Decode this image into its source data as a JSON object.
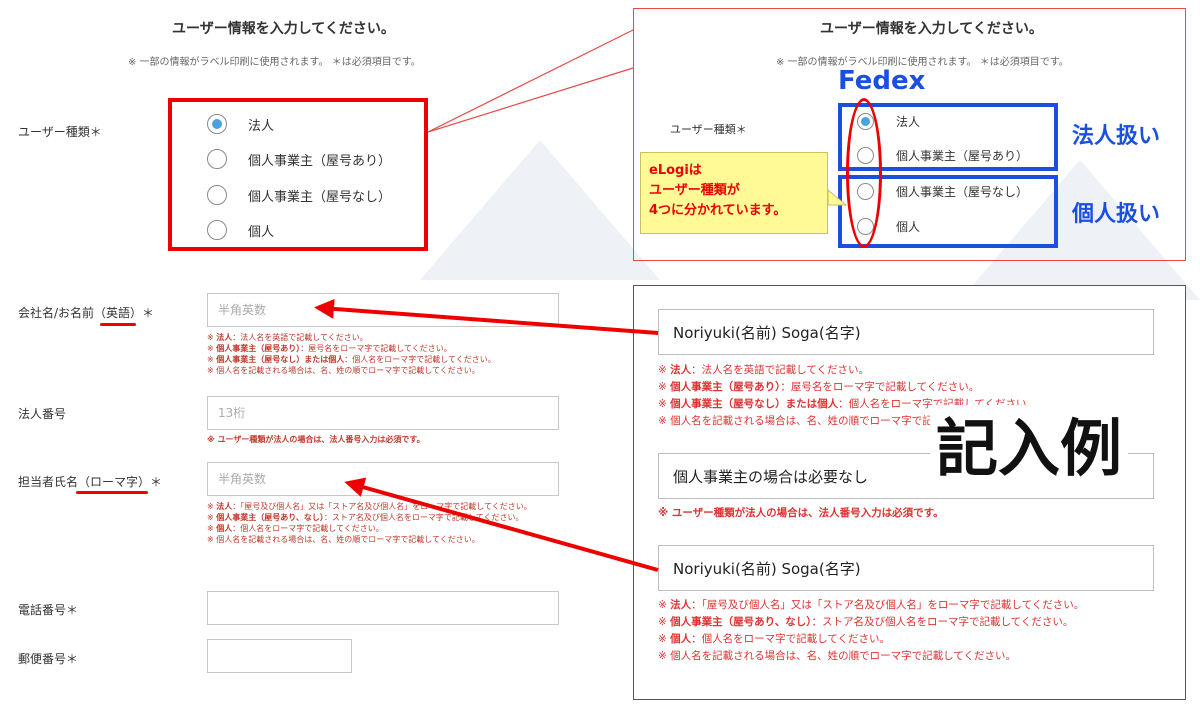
{
  "left_form": {
    "title": "ユーザー情報を入力してください。",
    "subtitle": "※ 一部の情報がラベル印刷に使用されます。 ＊は必須項目です。",
    "user_type": {
      "label": "ユーザー種類＊",
      "options": [
        {
          "label": "法人",
          "selected": true
        },
        {
          "label": "個人事業主（屋号あり）",
          "selected": false
        },
        {
          "label": "個人事業主（屋号なし）",
          "selected": false
        },
        {
          "label": "個人",
          "selected": false
        }
      ]
    },
    "company_name": {
      "label": "会社名/お名前（英語）＊",
      "placeholder": "半角英数",
      "hints": [
        {
          "prefix": "※ ",
          "bold": "法人",
          "rest": "：法人名を英語で記載してください。"
        },
        {
          "prefix": "※ ",
          "bold": "個人事業主（屋号あり）",
          "rest": "：屋号名をローマ字で記載してください。"
        },
        {
          "prefix": "※ ",
          "bold": "個人事業主（屋号なし）または個人",
          "rest": "：個人名をローマ字で記載してください。"
        },
        {
          "prefix": "※ ",
          "bold": "",
          "rest": "個人名を記載される場合は、名、姓の順でローマ字で記載してください。"
        }
      ]
    },
    "corp_number": {
      "label": "法人番号",
      "placeholder": "13桁",
      "hint": "※ ユーザー種類が法人の場合は、法人番号入力は必須です。"
    },
    "contact_name": {
      "label": "担当者氏名（ローマ字）＊",
      "placeholder": "半角英数",
      "hints": [
        {
          "prefix": "※ ",
          "bold": "法人",
          "rest": "：「屋号及び個人名」又は「ストア名及び個人名」をローマ字で記載してください。"
        },
        {
          "prefix": "※ ",
          "bold": "個人事業主（屋号あり、なし）",
          "rest": "：ストア名及び個人名をローマ字で記載してください。"
        },
        {
          "prefix": "※ ",
          "bold": "個人",
          "rest": "：個人名をローマ字で記載してください。"
        },
        {
          "prefix": "※ ",
          "bold": "",
          "rest": "個人名を記載される場合は、名、姓の順でローマ字で記載してください。"
        }
      ]
    },
    "phone": {
      "label": "電話番号＊"
    },
    "postal": {
      "label": "郵便番号＊"
    }
  },
  "right_top": {
    "title": "ユーザー情報を入力してください。",
    "subtitle": "※ 一部の情報がラベル印刷に使用されます。 ＊は必須項目です。",
    "fedex_label": "Fedex",
    "user_type_label": "ユーザー種類＊",
    "options": [
      {
        "label": "法人",
        "selected": true
      },
      {
        "label": "個人事業主（屋号あり）",
        "selected": false
      },
      {
        "label": "個人事業主（屋号なし）",
        "selected": false
      },
      {
        "label": "個人",
        "selected": false
      }
    ],
    "corp_treat": "法人扱い",
    "indiv_treat": "個人扱い",
    "callout": [
      "eLogiは",
      "ユーザー種類が",
      "4つに分かれています。"
    ]
  },
  "example": {
    "title": "記入例",
    "company_value": "Noriyuki(名前) Soga(名字)",
    "company_hints": [
      {
        "prefix": "※ ",
        "bold": "法人",
        "rest": "：法人名を英語で記載してください。"
      },
      {
        "prefix": "※ ",
        "bold": "個人事業主（屋号あり）",
        "rest": "：屋号名をローマ字で記載してください。"
      },
      {
        "prefix": "※ ",
        "bold": "個人事業主（屋号なし）または個人",
        "rest": "：個人名をローマ字で記載してください。"
      },
      {
        "prefix": "※ ",
        "bold": "",
        "rest": "個人名を記載される場合は、名、姓の順でローマ字で記載してください。"
      }
    ],
    "corp_value": "個人事業主の場合は必要なし",
    "corp_hint": "※ ユーザー種類が法人の場合は、法人番号入力は必須です。",
    "contact_value": "Noriyuki(名前) Soga(名字)",
    "contact_hints": [
      {
        "prefix": "※ ",
        "bold": "法人",
        "rest": "：「屋号及び個人名」又は「ストア名及び個人名」をローマ字で記載してください。"
      },
      {
        "prefix": "※ ",
        "bold": "個人事業主（屋号あり、なし）",
        "rest": "：ストア名及び個人名をローマ字で記載してください。"
      },
      {
        "prefix": "※ ",
        "bold": "個人",
        "rest": "：個人名をローマ字で記載してください。"
      },
      {
        "prefix": "※ ",
        "bold": "",
        "rest": "個人名を記載される場合は、名、姓の順でローマ字で記載してください。"
      }
    ]
  },
  "colors": {
    "annotation_red": "#ee0000",
    "annotation_blue": "#1a4fe0",
    "radio_selected": "#4aa3df",
    "hint_red": "#c0392b",
    "callout_bg": "#fffa96"
  }
}
